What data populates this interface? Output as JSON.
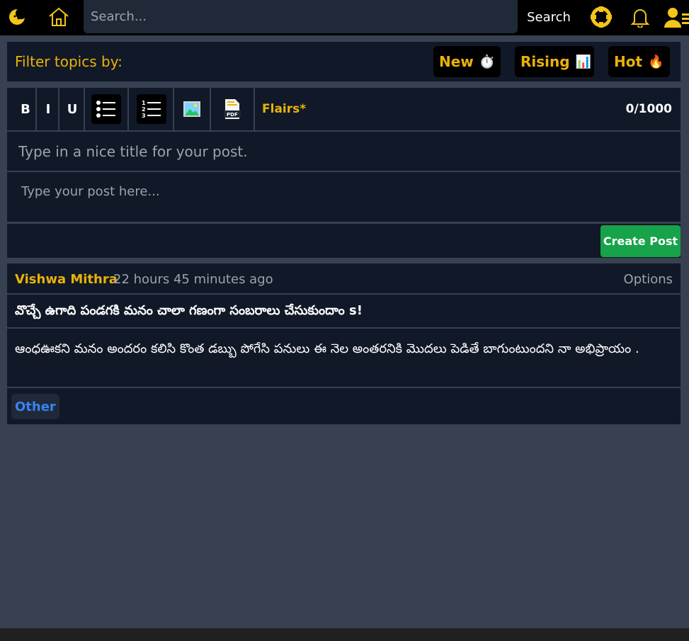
{
  "nav": {
    "search_placeholder": "Search...",
    "search_button": "Search"
  },
  "filter": {
    "label": "Filter topics by:",
    "options": [
      {
        "label": "New",
        "emoji": "⏱️"
      },
      {
        "label": "Rising",
        "emoji": "📊"
      },
      {
        "label": "Hot",
        "emoji": "🔥"
      }
    ]
  },
  "editor": {
    "bold": "B",
    "italic": "I",
    "underline": "U",
    "flairs": "Flairs*",
    "counter": "0/1000",
    "title_placeholder": "Type in a nice title for your post.",
    "body_placeholder": "Type your post here...",
    "create_button": "Create Post"
  },
  "post": {
    "author": "Vishwa Mithra",
    "time": "22 hours 45 minutes ago",
    "options": "Options",
    "title": "వొచ్చే ఉగాది పండగకి మనం చాలా గణంగా సంబరాలు చేసుకుందాం s!",
    "body": "ఆంధఊకని మనం అందరం కలిసి కొంత డబ్బు పోగేసి పనులు ఈ నెల అంతరనికి మొదలు పెడితే బాగుంటుందని నా అభిప్రాయం .",
    "tag": "Other"
  },
  "colors": {
    "accent": "#eab308",
    "background": "#374151",
    "panel": "#111827",
    "create": "#16a34a",
    "tag": "#3b82f6"
  }
}
